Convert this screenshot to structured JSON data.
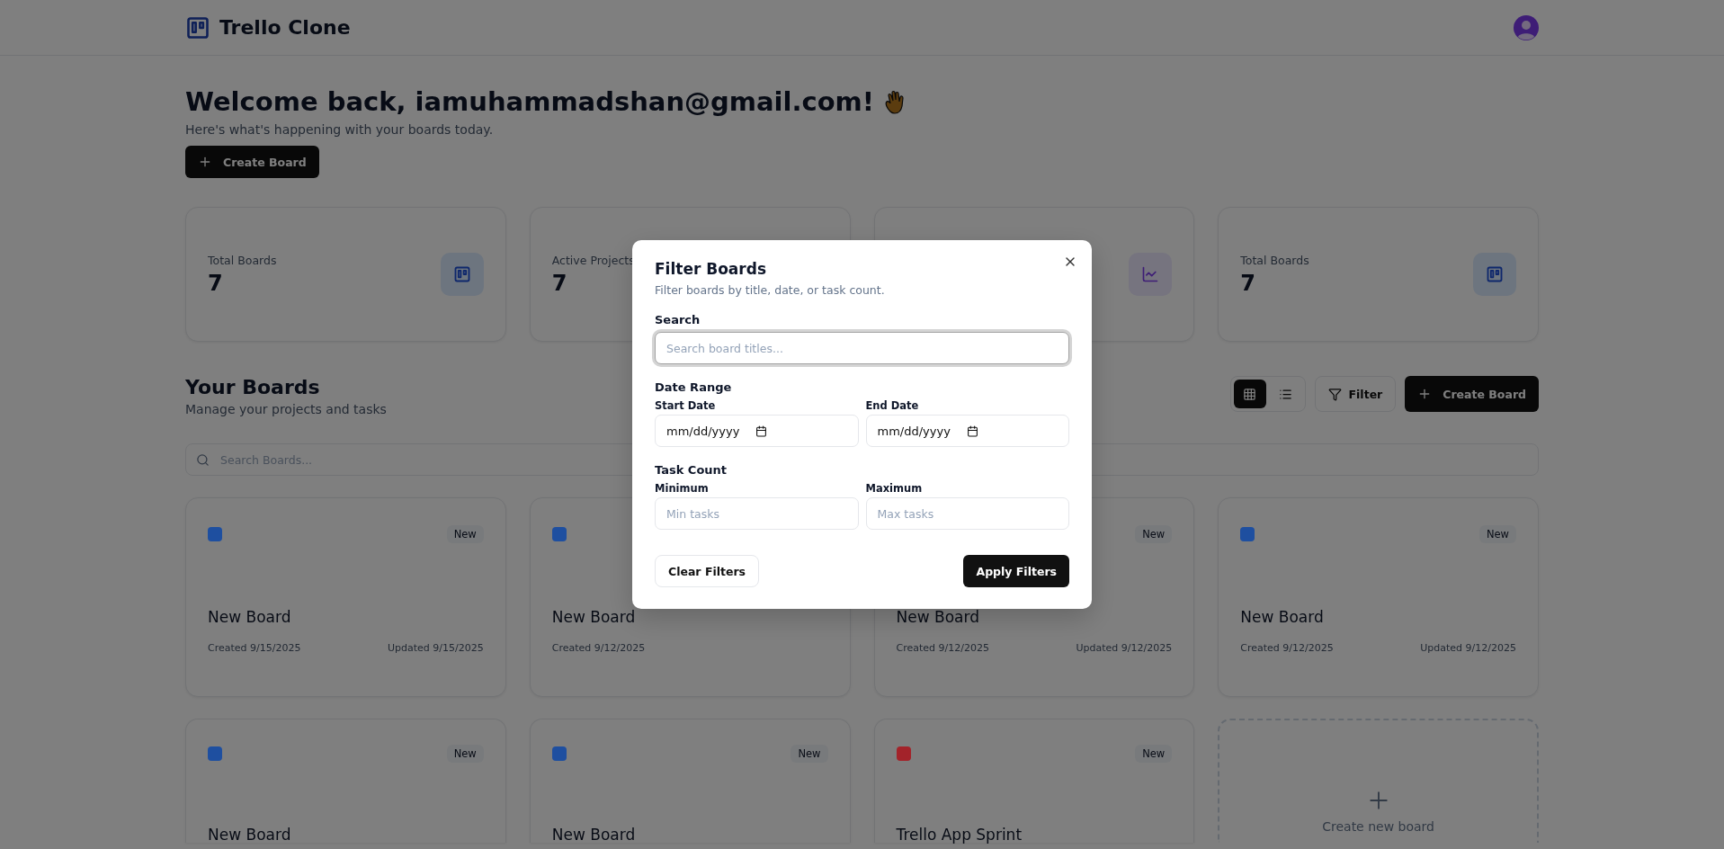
{
  "header": {
    "app_name": "Trello Clone"
  },
  "welcome": {
    "title": "Welcome back, iamuhammadshan@gmail.com!",
    "subtitle": "Here's what's happening with your boards today.",
    "create_button": "Create Board"
  },
  "stat_cards": [
    {
      "kind": "board",
      "label": "Total Boards",
      "value": "7"
    },
    {
      "kind": "plain",
      "label": "Active Projects",
      "value": "7"
    },
    {
      "kind": "chart"
    },
    {
      "kind": "board",
      "label": "Total Boards",
      "value": "7"
    }
  ],
  "boards_section": {
    "title": "Your Boards",
    "subtitle": "Manage your projects and tasks",
    "view_toggle": [
      {
        "kind": "grid",
        "selected": true
      },
      {
        "kind": "list",
        "selected": false
      }
    ],
    "filter_button": "Filter",
    "create_button": "Create Board",
    "search": {
      "placeholder": "Search Boards..."
    }
  },
  "boards": [
    {
      "kind": "board",
      "color": "#1e4fa0",
      "badge": "New",
      "title": "New Board",
      "created": "Created 9/15/2025",
      "updated": "Updated 9/15/2025"
    },
    {
      "kind": "board",
      "color": "#1e4fa0",
      "title": "New Board",
      "created": "Created 9/12/2025"
    },
    {
      "kind": "board",
      "badge": "New",
      "title": "New Board",
      "created": "Created 9/12/2025",
      "updated": "Updated 9/12/2025"
    },
    {
      "kind": "board",
      "color": "#1e4fa0",
      "badge": "New",
      "title": "New Board",
      "created": "Created 9/12/2025",
      "updated": "Updated 9/12/2025"
    },
    {
      "kind": "board",
      "color": "#1e4fa0",
      "badge": "New",
      "title": "New Board"
    },
    {
      "kind": "board",
      "color": "#1e4fa0",
      "badge": "New",
      "title": "New Board"
    },
    {
      "kind": "board",
      "color": "#a3232a",
      "badge": "New",
      "title": "Trello App Sprint"
    },
    {
      "kind": "create",
      "label": "Create new board"
    }
  ],
  "dialog": {
    "title": "Filter Boards",
    "description": "Filter boards by title, date, or task count.",
    "search_label": "Search",
    "search": {
      "placeholder": "Search board titles...",
      "focused": true
    },
    "date_label": "Date Range",
    "start_label": "Start Date",
    "start_value": "mm/dd/yyyy",
    "end_label": "End Date",
    "end_value": "mm/dd/yyyy",
    "task_label": "Task Count",
    "min_label": "Minimum",
    "min": {
      "placeholder": "Min tasks"
    },
    "max_label": "Maximum",
    "max": {
      "placeholder": "Max tasks"
    },
    "clear_button": "Clear Filters",
    "apply_button": "Apply Filters"
  }
}
